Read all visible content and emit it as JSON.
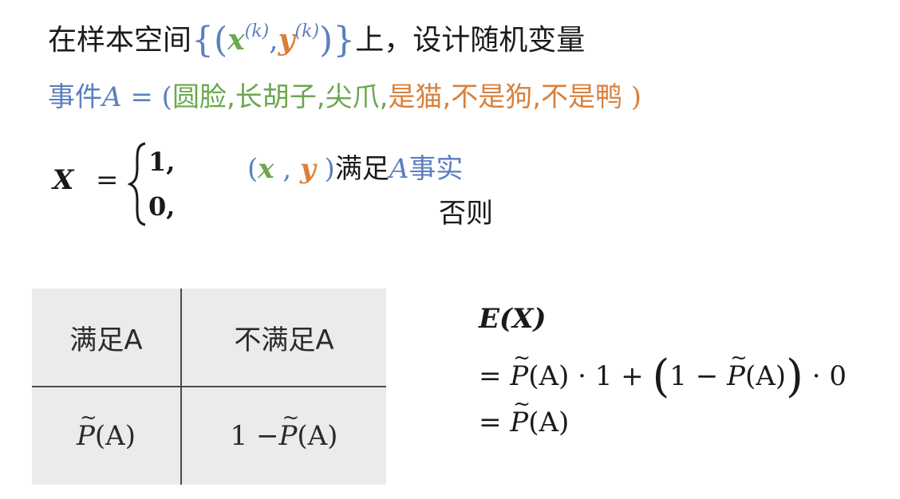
{
  "line1": {
    "prefix": "在样本空间",
    "x_sym": "x",
    "y_sym": "y",
    "sup": "(k)",
    "comma": ",",
    "suffix": "上，设计随机变量"
  },
  "line2": {
    "label": "事件",
    "event": "A",
    "eq": " = (",
    "features_green": [
      "圆脸",
      "长胡子",
      "尖爪"
    ],
    "features_orange": [
      "是猫",
      "不是狗",
      "不是鸭"
    ],
    "close": " )"
  },
  "piecewise": {
    "var": "X",
    "eq": "=",
    "case1_value": "1,",
    "case2_value": "0,",
    "case1_x": "x",
    "case1_y": "y",
    "case1_text": "满足",
    "case1_event": "A",
    "case1_tail": "事实",
    "case2_text": "否则"
  },
  "table": {
    "headers": [
      "满足A",
      "不满足A"
    ],
    "probs": [
      "P(A)",
      "1 − P(A)"
    ]
  },
  "expectation": {
    "line1": "E(X)",
    "line2_lhs": "= ",
    "line2_a": "(A) · 1 + ",
    "line2_b": "1 − ",
    "line2_c": "(A)",
    "line2_d": " · 0",
    "line3_lhs": "= ",
    "line3_a": "(A)"
  },
  "colors": {
    "blue": "#5b7fbf",
    "green": "#6aa84f",
    "orange": "#d9803c"
  }
}
